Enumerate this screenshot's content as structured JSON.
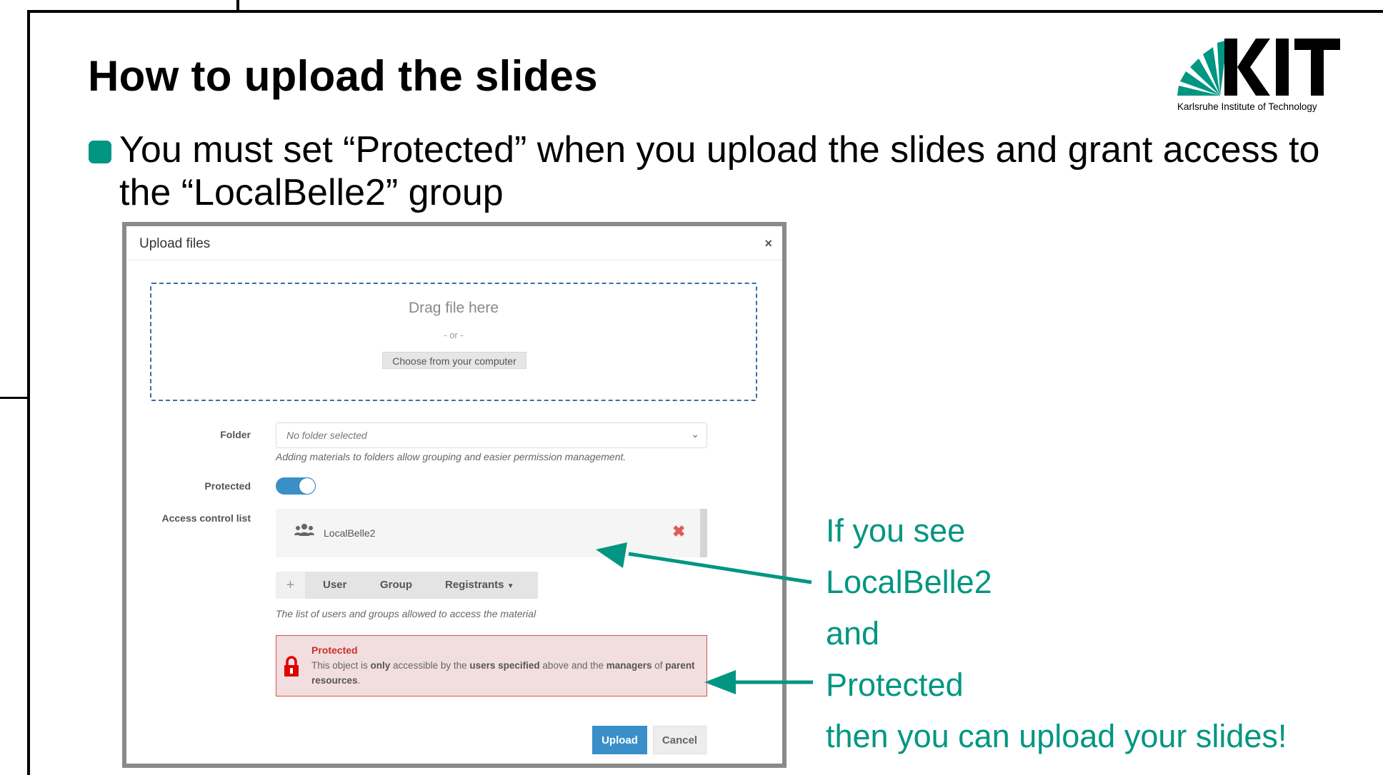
{
  "slide": {
    "title": "How to upload the slides",
    "bullet": "You must set “Protected” when you upload the slides and grant access to the “LocalBelle2” group"
  },
  "logo": {
    "text": "Karlsruhe Institute of Technology",
    "wordmark": "KIT",
    "brand_color": "#009682"
  },
  "dialog": {
    "title": "Upload files",
    "close_label": "×",
    "dropzone": {
      "title": "Drag file here",
      "or": "- or -",
      "choose_label": "Choose from your computer"
    },
    "folder": {
      "label": "Folder",
      "value": "No folder selected",
      "help": "Adding materials to folders allow grouping and easier permission management."
    },
    "protected": {
      "label": "Protected",
      "state": "on"
    },
    "acl": {
      "label": "Access control list",
      "entries": [
        {
          "name": "LocalBelle2",
          "icon": "group-icon"
        }
      ],
      "remove_label": "✖",
      "add_label": "+",
      "buttons": {
        "user": "User",
        "group": "Group",
        "registrants": "Registrants"
      },
      "help": "The list of users and groups allowed to access the material"
    },
    "alert": {
      "title": "Protected",
      "text_parts": [
        "This object is ",
        "only",
        " accessible by the ",
        "users specified",
        " above and the ",
        "managers",
        " of ",
        "parent resources",
        "."
      ]
    },
    "upload_label": "Upload",
    "cancel_label": "Cancel"
  },
  "annotation": {
    "lines": [
      "If you see",
      "LocalBelle2",
      "and",
      "Protected",
      "then you can upload your slides!"
    ],
    "color": "#009682"
  }
}
